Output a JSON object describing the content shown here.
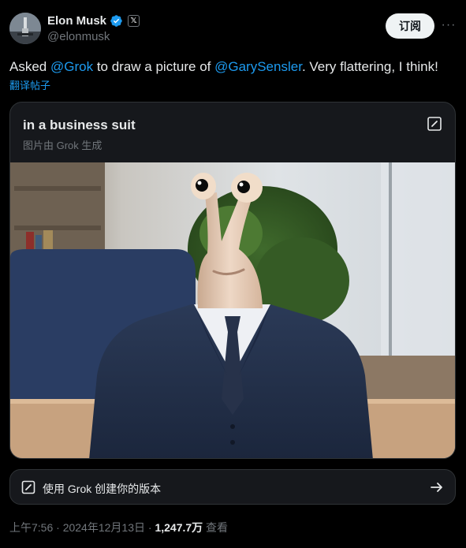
{
  "author": {
    "name": "Elon Musk",
    "handle": "@elonmusk",
    "x_badge": "𝕏"
  },
  "actions": {
    "subscribe_label": "订阅",
    "more_label": "···"
  },
  "tweet": {
    "text_1": "Asked ",
    "mention_1": "@Grok",
    "text_2": " to draw a picture of ",
    "mention_2": "@GarySensler",
    "text_3": ". Very flattering, I think!",
    "translate_label": "翻译帖子"
  },
  "card": {
    "title": "in a business suit",
    "subtitle": "图片由 Grok 生成",
    "image_description_icon": "generated-image"
  },
  "grok_button": {
    "label": "使用 Grok 创建你的版本"
  },
  "meta": {
    "time": "上午7:56",
    "sep1": " · ",
    "date": "2024年12月13日",
    "sep2": " · ",
    "views_count": "1,247.7万",
    "views_label": " 查看"
  },
  "colors": {
    "background": "#000000",
    "accent": "#1d9bf0",
    "text_primary": "#e7e9ea",
    "text_secondary": "#71767b",
    "border": "#2f3336"
  }
}
